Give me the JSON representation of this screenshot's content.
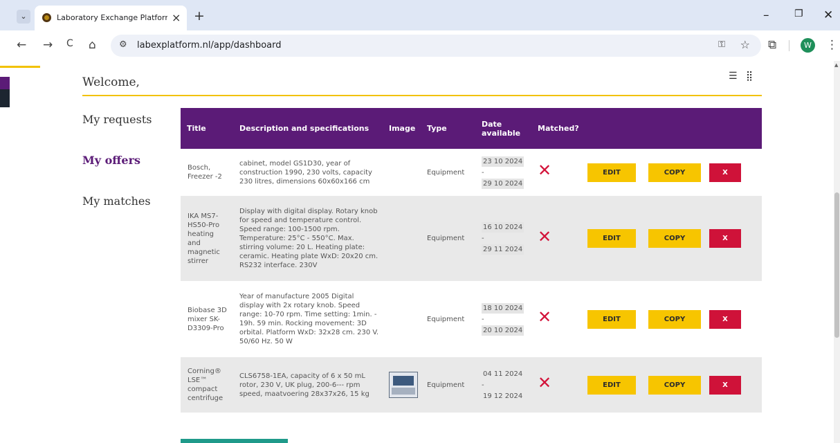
{
  "browser": {
    "tab_title": "Laboratory Exchange Platform (",
    "url": "labexplatform.nl/app/dashboard",
    "avatar_letter": "W",
    "new_tab": "+",
    "tab_close": "×",
    "min_label": "–",
    "max_label": "❐",
    "close_label": "✕",
    "tab_list_label": "⌄",
    "back_label": "←",
    "forward_label": "→",
    "reload_label": "C",
    "home_label": "⌂",
    "site_info_label": "⚙",
    "password_key_label": "⚿",
    "bookmark_label": "☆",
    "extensions_label": "⧉",
    "menu_label": "⋮"
  },
  "page": {
    "welcome": "Welcome,",
    "list_view_icon": "☰",
    "grid_view_icon": "⣿"
  },
  "nav": {
    "requests": "My requests",
    "offers": "My offers",
    "matches": "My matches"
  },
  "table": {
    "headers": {
      "title": "Title",
      "description": "Description and specifications",
      "image": "Image",
      "type": "Type",
      "date_line1": "Date",
      "date_line2": "available",
      "matched": "Matched?"
    },
    "rows": [
      {
        "title": "Bosch, Freezer -2",
        "description": "cabinet, model GS1D30, year of construction 1990, 230 volts, capacity 230 litres, dimensions 60x60x166 cm",
        "type": "Equipment",
        "date_from": "23 10 2024",
        "date_sep": "-",
        "date_to": "29 10 2024",
        "matched": "✕",
        "edit": "EDIT",
        "copy": "COPY",
        "delete": "X"
      },
      {
        "title": "IKA MS7-HS50-Pro heating and magnetic stirrer",
        "description": "Display with digital display. Rotary knob for speed and temperature control. Speed range: 100-1500 rpm. Temperature: 25°C - 550°C. Max. stirring volume: 20 L. Heating plate: ceramic. Heating plate WxD: 20x20 cm. RS232 interface. 230V",
        "type": "Equipment",
        "date_from": "16 10 2024",
        "date_sep": "-",
        "date_to": "29 11 2024",
        "matched": "✕",
        "edit": "EDIT",
        "copy": "COPY",
        "delete": "X"
      },
      {
        "title": "Biobase 3D mixer SK-D3309-Pro",
        "description": "Year of manufacture 2005 Digital display with 2x rotary knob. Speed range: 10-70 rpm. Time setting: 1min. - 19h. 59 min. Rocking movement: 3D orbital. Platform WxD: 32x28 cm. 230 V. 50/60 Hz. 50 W",
        "type": "Equipment",
        "date_from": "18 10 2024",
        "date_sep": "-",
        "date_to": "20 10 2024",
        "matched": "✕",
        "edit": "EDIT",
        "copy": "COPY",
        "delete": "X"
      },
      {
        "title": "Corning® LSE™ compact centrifuge",
        "description": "CLS6758-1EA, capacity of 6 x 50 mL rotor, 230 V, UK plug, 200-6--- rpm speed, maatvoering 28x37x26, 15 kg",
        "type": "Equipment",
        "date_from": "04 11 2024",
        "date_sep": "-",
        "date_to": "19 12 2024",
        "matched": "✕",
        "edit": "EDIT",
        "copy": "COPY",
        "delete": "X"
      }
    ]
  }
}
